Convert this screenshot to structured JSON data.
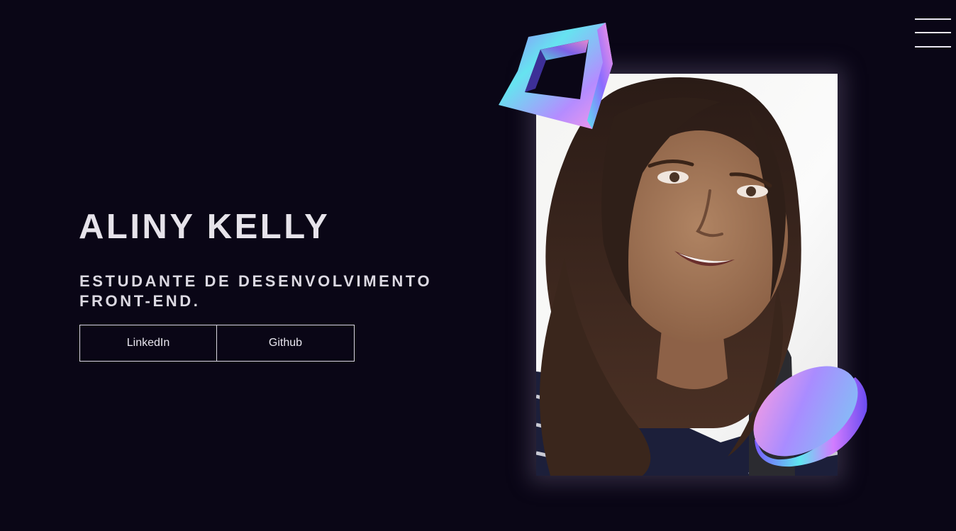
{
  "hero": {
    "name": "ALINY KELLY",
    "subtitle": "ESTUDANTE DE DESENVOLVIMENTO FRONT-END.",
    "buttons": [
      {
        "label": "LinkedIn"
      },
      {
        "label": "Github"
      }
    ]
  },
  "nav": {
    "menu_icon": "hamburger-menu-icon"
  },
  "media": {
    "profile_photo": "profile-photo",
    "decorations": [
      "holographic-square-frame",
      "holographic-disc"
    ]
  },
  "colors": {
    "background": "#0a0616",
    "text": "#e6e3ea",
    "accent_gradient": [
      "#7a5cff",
      "#58e6f0",
      "#ff8be8"
    ]
  }
}
